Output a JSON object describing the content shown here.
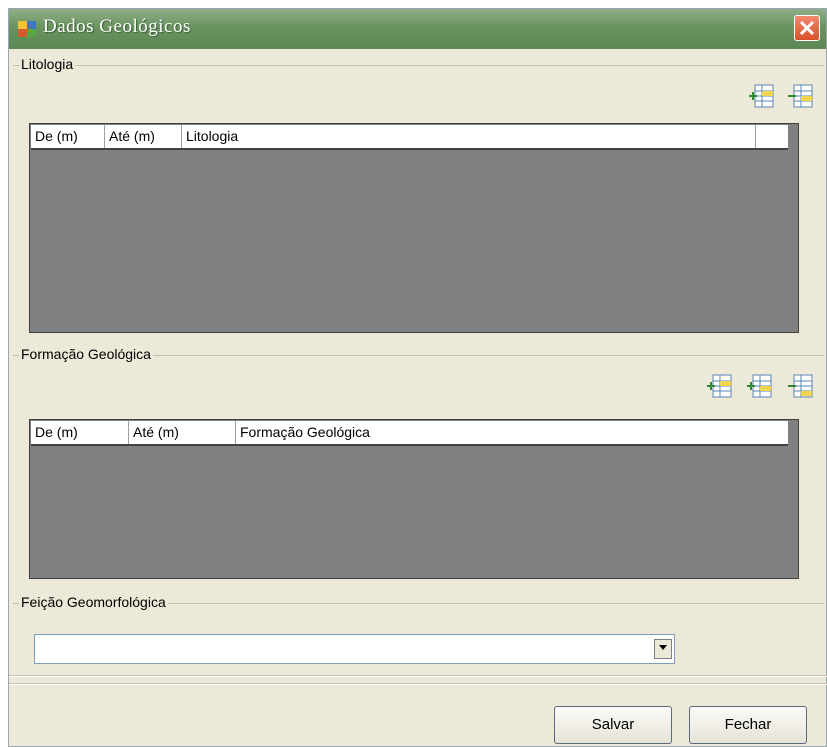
{
  "window": {
    "title": "Dados Geológicos"
  },
  "litologia": {
    "label": "Litologia",
    "columns": [
      "De (m)",
      "Até (m)",
      "Litologia"
    ]
  },
  "formacao": {
    "label": "Formação Geológica",
    "columns": [
      "De (m)",
      "Até (m)",
      "Formação Geológica"
    ]
  },
  "feicao": {
    "label": "Feição Geomorfológica",
    "value": ""
  },
  "buttons": {
    "save": "Salvar",
    "close": "Fechar"
  },
  "icons": {
    "app": "app-icon",
    "close": "close-icon",
    "add_row": "add-row-icon",
    "remove_row": "remove-row-icon",
    "insert_row": "insert-row-icon"
  },
  "colors": {
    "titlebar": "#6a9360",
    "grid_bg": "#808080",
    "window_bg": "#ece9d8"
  }
}
